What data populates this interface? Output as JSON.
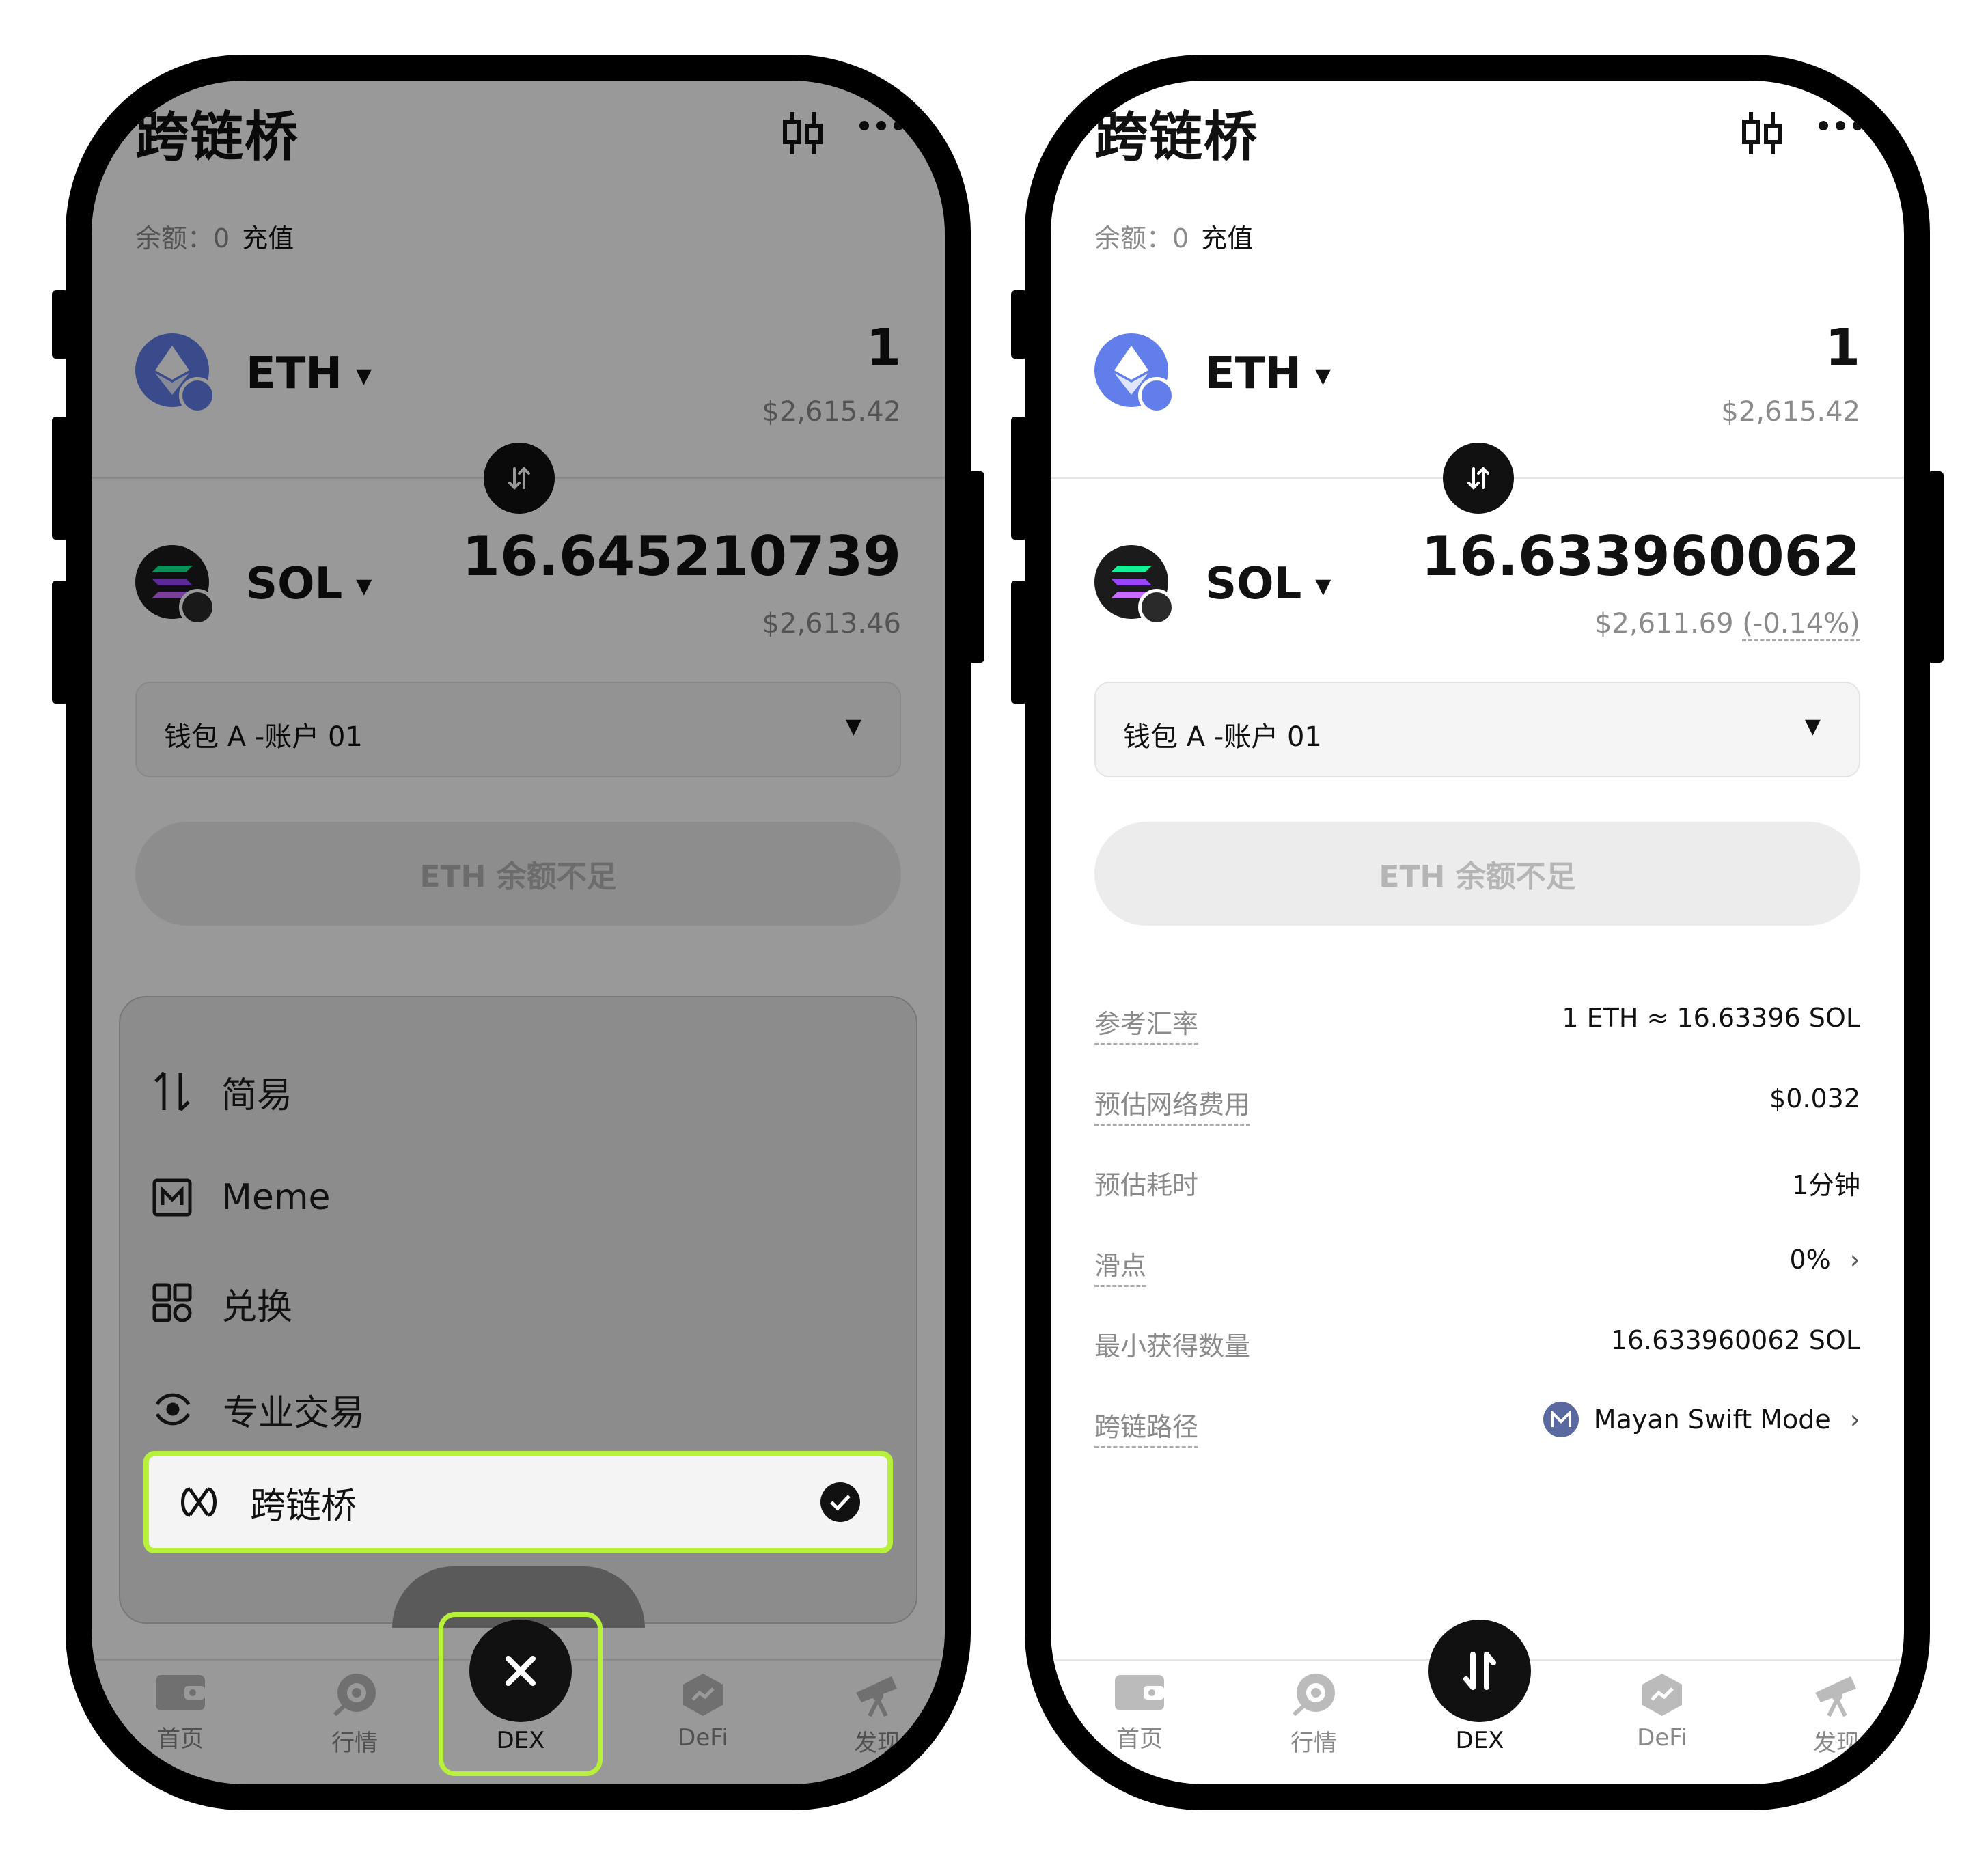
{
  "header": {
    "title": "跨链桥"
  },
  "balance": {
    "label": "余额：",
    "value": "0",
    "recharge": "充值"
  },
  "from_token": {
    "symbol": "ETH",
    "amount": "1",
    "usd": "$2,615.42"
  },
  "to_token_left": {
    "symbol": "SOL",
    "amount": "16.645210739",
    "usd": "$2,613.46"
  },
  "to_token_right": {
    "symbol": "SOL",
    "amount": "16.633960062",
    "usd": "$2,611.69",
    "change": "(-0.14%)"
  },
  "wallet": {
    "label": "钱包 A -账户 01"
  },
  "action": {
    "label": "ETH 余额不足"
  },
  "details": {
    "rate_label": "参考汇率",
    "rate_value": "1 ETH ≈ 16.63396 SOL",
    "fee_label": "预估网络费用",
    "fee_value": "$0.032",
    "time_label": "预估耗时",
    "time_value": "1分钟",
    "slippage_label": "滑点",
    "slippage_value": "0%",
    "min_label": "最小获得数量",
    "min_value": "16.633960062 SOL",
    "route_label": "跨链路径",
    "route_value": "Mayan Swift Mode"
  },
  "menu": {
    "items": [
      {
        "label": "简易",
        "icon": "sort-arrows-icon"
      },
      {
        "label": "Meme",
        "icon": "meme-icon"
      },
      {
        "label": "兑换",
        "icon": "exchange-icon"
      },
      {
        "label": "专业交易",
        "icon": "pro-trade-icon"
      },
      {
        "label": "跨链桥",
        "icon": "bridge-icon",
        "selected": true
      }
    ]
  },
  "tabs": {
    "home": "首页",
    "market": "行情",
    "dex": "DEX",
    "defi": "DeFi",
    "discover": "发现"
  },
  "colors": {
    "highlight": "#b8f13a",
    "eth": "#627eea",
    "dark": "#111111"
  }
}
